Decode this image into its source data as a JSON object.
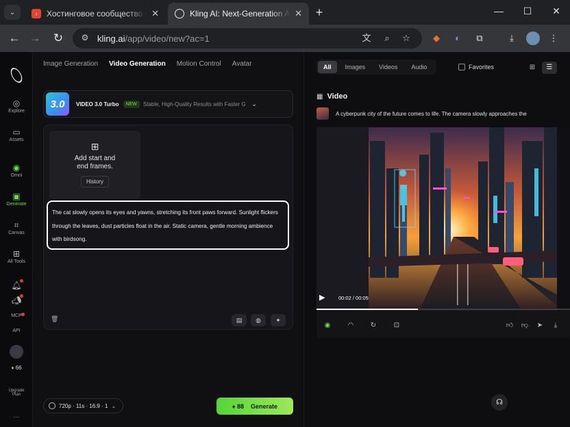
{
  "browser": {
    "tabs": [
      {
        "title": "Хостинговое сообщество «Tim",
        "favicon": "chevron-icon"
      },
      {
        "title": "Kling AI: Next-Generation AI Cr",
        "favicon": "kling-logo-icon"
      }
    ],
    "url_domain": "kling.ai",
    "url_path": "/app/video/new?ac=1"
  },
  "rail": {
    "items": [
      {
        "label": "Explore",
        "icon": "compass-icon"
      },
      {
        "label": "Assets",
        "icon": "folder-icon"
      },
      {
        "label": "Omni",
        "icon": "omni-icon"
      },
      {
        "label": "Generate",
        "icon": "generate-icon",
        "active": true
      },
      {
        "label": "Canvas",
        "icon": "canvas-icon"
      },
      {
        "label": "All Tools",
        "icon": "grid-icon"
      }
    ],
    "mcp": "MCP",
    "api": "API",
    "credits": "66",
    "upgrade": "Upgrade",
    "plan": "Plan",
    "more": "···"
  },
  "mode_tabs": [
    "Image Generation",
    "Video Generation",
    "Motion Control",
    "Avatar"
  ],
  "active_mode": "Video Generation",
  "model": {
    "badge": "3.0",
    "badge_sub": "Turbo",
    "name": "VIDEO 3.0 Turbo",
    "new_tag": "NEW",
    "description": "Stable, High-Quality Results with Faster Gener..."
  },
  "frames": {
    "label_line1": "Add start and",
    "label_line2": "end frames.",
    "history": "History"
  },
  "prompt_text": "The cat slowly opens its eyes and yawns, stretching its front paws forward. Sunlight flickers through the leaves, dust particles float in the air. Static camera, gentle morning ambience with birdsong.",
  "settings_summary": "720p · 11s · 16:9 · 1",
  "generate": {
    "cost": "88",
    "label": "Generate"
  },
  "gallery": {
    "filters": [
      "All",
      "Images",
      "Videos",
      "Audio"
    ],
    "active_filter": "All",
    "favorites": "Favorites",
    "section_title": "Video",
    "video_prompt": "A cyberpunk city of the future comes to life. The camera slowly approaches the",
    "time": "00:02 / 00:05",
    "progress": 0.4
  },
  "colors": {
    "accent": "#6cdc4a",
    "generate_start": "#53d43a",
    "generate_end": "#9ee85a"
  }
}
